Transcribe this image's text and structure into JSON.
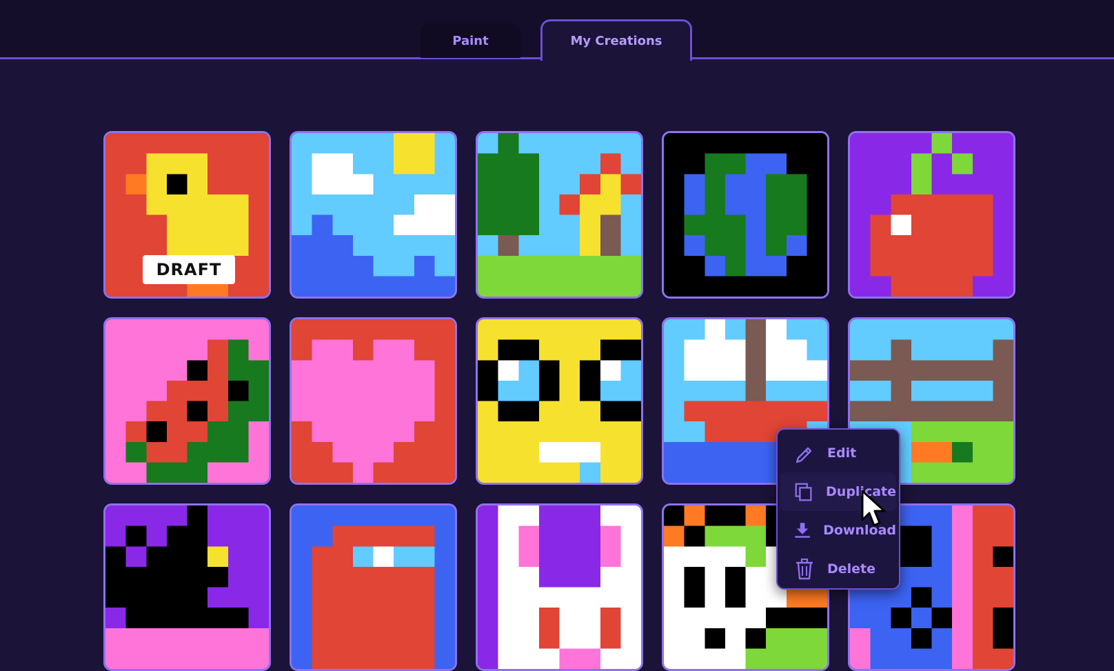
{
  "tabs": [
    {
      "label": "Paint",
      "active": false
    },
    {
      "label": "My Creations",
      "active": true
    }
  ],
  "gallery": {
    "draft_badge": "DRAFT",
    "items": [
      {
        "subject": "duck",
        "draft": true
      },
      {
        "subject": "sky with clouds and sun"
      },
      {
        "subject": "house with tree"
      },
      {
        "subject": "earth globe"
      },
      {
        "subject": "apple"
      },
      {
        "subject": "watermelon slice"
      },
      {
        "subject": "heart"
      },
      {
        "subject": "face"
      },
      {
        "subject": "sailboat"
      },
      {
        "subject": "fence"
      },
      {
        "subject": "cat"
      },
      {
        "subject": "red character"
      },
      {
        "subject": "bunny"
      },
      {
        "subject": "panda"
      },
      {
        "subject": "pattern"
      }
    ]
  },
  "context_menu": {
    "items": [
      {
        "label": "Edit",
        "icon": "pencil-icon"
      },
      {
        "label": "Duplicate",
        "icon": "duplicate-icon",
        "hovered": true
      },
      {
        "label": "Download",
        "icon": "download-icon"
      },
      {
        "label": "Delete",
        "icon": "trash-icon"
      }
    ]
  },
  "colors": {
    "background": "#1b1338",
    "topbar": "#140e2a",
    "accent": "#6f4fd6",
    "menu_text": "#a889ff",
    "thumb_border": "#8f72ee"
  }
}
